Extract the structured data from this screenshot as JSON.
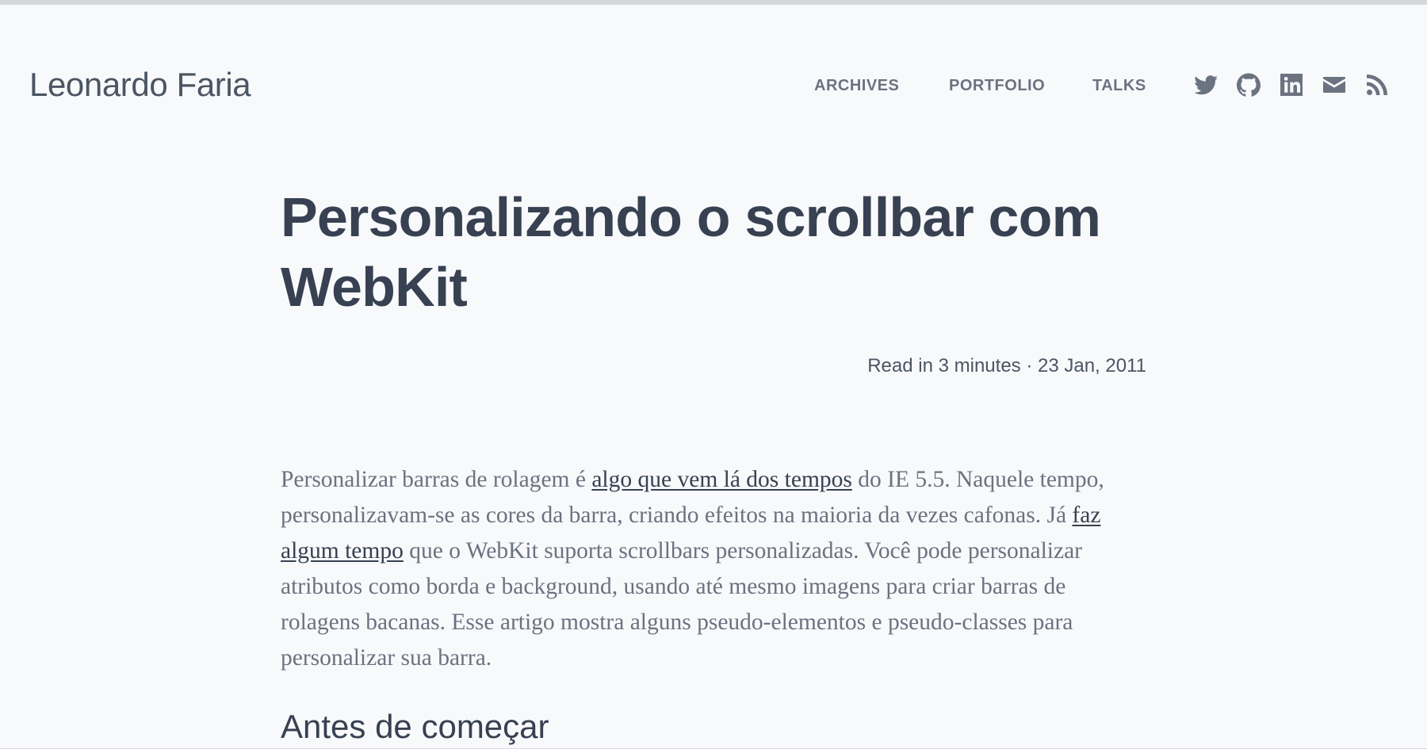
{
  "site": {
    "title": "Leonardo Faria"
  },
  "nav": {
    "items": [
      {
        "label": "ARCHIVES"
      },
      {
        "label": "PORTFOLIO"
      },
      {
        "label": "TALKS"
      }
    ]
  },
  "social": [
    {
      "icon": "twitter-icon"
    },
    {
      "icon": "github-icon"
    },
    {
      "icon": "linkedin-icon"
    },
    {
      "icon": "email-icon"
    },
    {
      "icon": "rss-icon"
    }
  ],
  "post": {
    "title": "Personalizando o scrollbar com WebKit",
    "meta": "Read in 3 minutes · 23 Jan, 2011",
    "paragraph": {
      "part1": "Personalizar barras de rolagem é ",
      "link1": "algo que vem lá dos tempos",
      "part2": " do IE 5.5. Naquele tempo, personalizavam-se as cores da barra, criando efeitos na maioria da vezes cafonas. Já ",
      "link2": "faz algum tempo",
      "part3": " que o WebKit suporta scrollbars personalizadas. Você pode personalizar atributos como borda e background, usando até mesmo imagens para criar barras de rolagens bacanas. Esse artigo mostra alguns pseudo-elementos e pseudo-classes para personalizar sua barra."
    },
    "section_heading": "Antes de começar"
  },
  "colors": {
    "background": "#f8f9fb",
    "text_dark": "#374151",
    "text_muted": "#6b7280",
    "top_bar": "#d6d8de"
  }
}
